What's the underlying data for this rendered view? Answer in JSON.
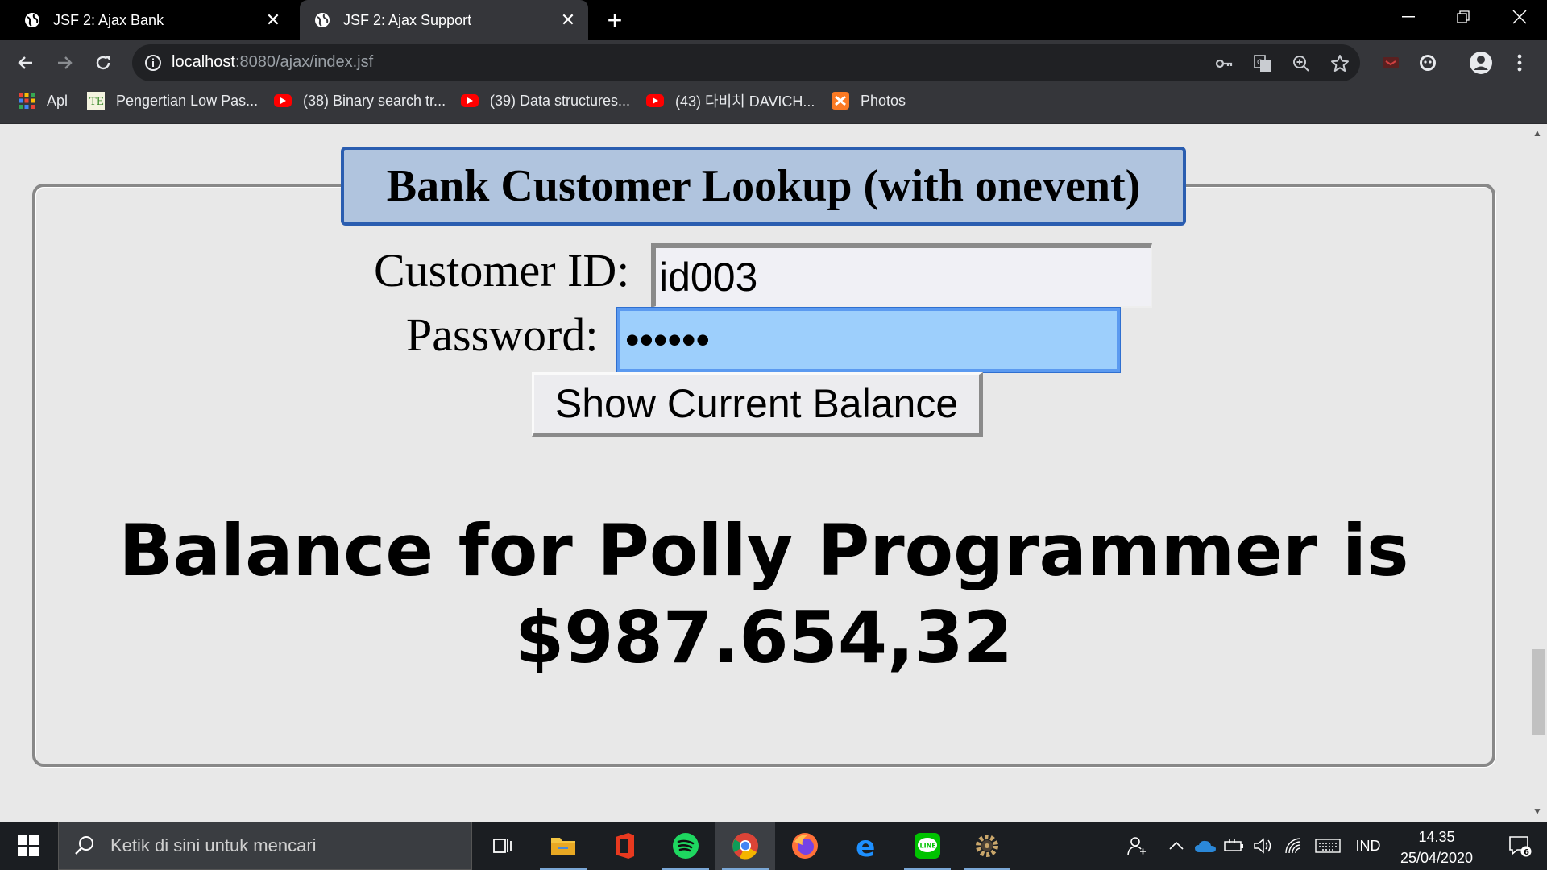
{
  "browser": {
    "tabs": [
      {
        "title": "JSF 2: Ajax Bank",
        "active": false
      },
      {
        "title": "JSF 2: Ajax Support",
        "active": true
      }
    ],
    "url_host": "localhost",
    "url_rest": ":8080/ajax/index.jsf",
    "bookmarks": [
      {
        "label": "Apl",
        "icon": "apps-grid-icon"
      },
      {
        "label": "Pengertian Low Pas...",
        "icon": "te-site-icon"
      },
      {
        "label": "(38) Binary search tr...",
        "icon": "youtube-icon"
      },
      {
        "label": "(39) Data structures...",
        "icon": "youtube-icon"
      },
      {
        "label": "(43) 다비치 DAVICH...",
        "icon": "youtube-icon"
      },
      {
        "label": "Photos",
        "icon": "xampp-icon"
      }
    ]
  },
  "page": {
    "legend": "Bank Customer Lookup (with onevent)",
    "customer_id_label": "Customer ID:",
    "customer_id_value": "id003",
    "password_label": "Password:",
    "password_value": "••••••",
    "submit_label": "Show Current Balance",
    "result_line1": "Balance for Polly Programmer is",
    "result_line2": "$987.654,32"
  },
  "taskbar": {
    "search_placeholder": "Ketik di sini untuk mencari",
    "language": "IND",
    "time": "14.35",
    "date": "25/04/2020",
    "notification_count": "6"
  },
  "colors": {
    "legend_bg": "#b0c4de",
    "legend_border": "#2a5db0",
    "focused_input_bg": "#9dcffc"
  }
}
